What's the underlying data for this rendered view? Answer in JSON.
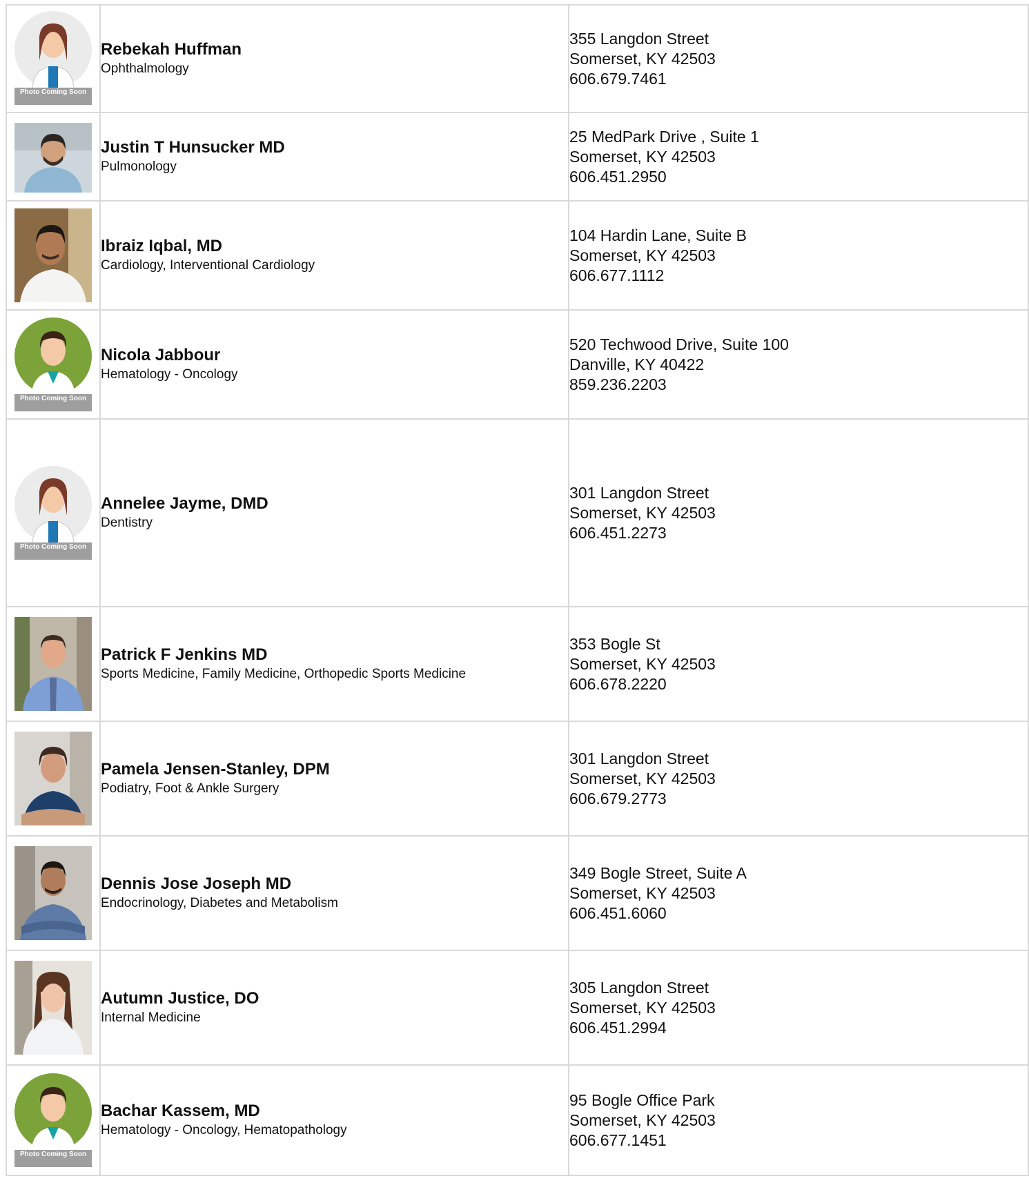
{
  "placeholder_label": "Photo Coming Soon",
  "providers": [
    {
      "name": "Rebekah Huffman",
      "specialty": "Ophthalmology",
      "address1": "355 Langdon Street",
      "address2": "Somerset, KY 42503",
      "phone": "606.679.7461",
      "photo": "placeholder-female-icon"
    },
    {
      "name": "Justin T Hunsucker MD",
      "specialty": "Pulmonology",
      "address1": "25 MedPark Drive , Suite 1",
      "address2": "Somerset, KY 42503",
      "phone": "606.451.2950",
      "photo": "provider-photo"
    },
    {
      "name": "Ibraiz Iqbal, MD",
      "specialty": "Cardiology, Interventional Cardiology",
      "address1": "104 Hardin Lane, Suite B",
      "address2": "Somerset, KY 42503",
      "phone": "606.677.1112",
      "photo": "provider-photo"
    },
    {
      "name": "Nicola Jabbour",
      "specialty": "Hematology - Oncology",
      "address1": "520 Techwood Drive, Suite 100",
      "address2": "Danville, KY 40422",
      "phone": "859.236.2203",
      "photo": "placeholder-male-icon"
    },
    {
      "name": "Annelee Jayme, DMD",
      "specialty": "Dentistry",
      "address1": "301 Langdon Street",
      "address2": "Somerset, KY 42503",
      "phone": "606.451.2273",
      "photo": "placeholder-female-icon"
    },
    {
      "name": "Patrick F Jenkins MD",
      "specialty": "Sports Medicine, Family Medicine, Orthopedic Sports Medicine",
      "address1": "353 Bogle St",
      "address2": "Somerset, KY 42503",
      "phone": "606.678.2220",
      "photo": "provider-photo"
    },
    {
      "name": "Pamela Jensen-Stanley, DPM",
      "specialty": "Podiatry, Foot & Ankle Surgery",
      "address1": "301 Langdon Street",
      "address2": "Somerset, KY 42503",
      "phone": "606.679.2773",
      "photo": "provider-photo"
    },
    {
      "name": "Dennis Jose Joseph MD",
      "specialty": "Endocrinology, Diabetes and Metabolism",
      "address1": "349 Bogle Street, Suite A",
      "address2": "Somerset, KY 42503",
      "phone": "606.451.6060",
      "photo": "provider-photo"
    },
    {
      "name": "Autumn Justice, DO",
      "specialty": "Internal Medicine",
      "address1": "305 Langdon Street",
      "address2": "Somerset, KY 42503",
      "phone": "606.451.2994",
      "photo": "provider-photo"
    },
    {
      "name": "Bachar Kassem, MD",
      "specialty": "Hematology - Oncology, Hematopathology",
      "address1": "95 Bogle Office Park",
      "address2": "Somerset, KY 42503",
      "phone": "606.677.1451",
      "photo": "placeholder-male-icon"
    }
  ]
}
